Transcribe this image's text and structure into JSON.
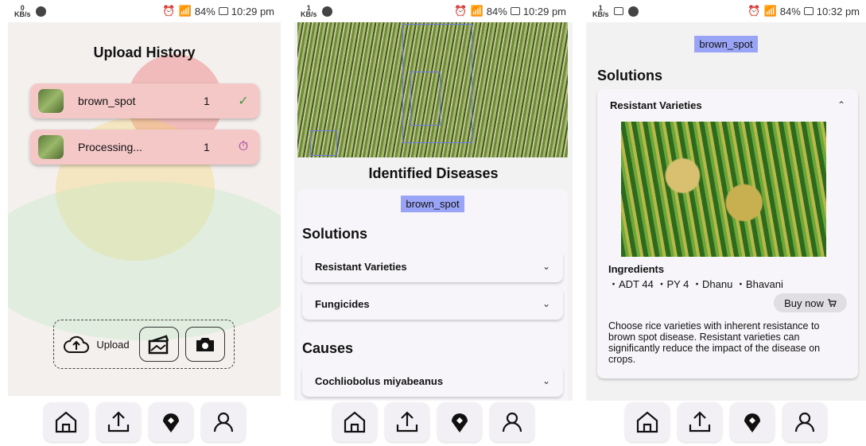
{
  "status": {
    "s1_time": "10:29 pm",
    "s2_time": "10:29 pm",
    "s3_time": "10:32 pm",
    "battery": "84%",
    "left1": "0",
    "left2": "1",
    "left3": "1",
    "kbs": "KB/s"
  },
  "screen1": {
    "title": "Upload History",
    "items": [
      {
        "name": "brown_spot",
        "count": "1",
        "status": "✓"
      },
      {
        "name": "Processing...",
        "count": "1",
        "status": "⏱"
      }
    ],
    "upload_label": "Upload"
  },
  "screen2": {
    "title": "Identified Diseases",
    "tag": "brown_spot",
    "solutions_title": "Solutions",
    "solutions": [
      {
        "label": "Resistant Varieties"
      },
      {
        "label": "Fungicides"
      }
    ],
    "causes_title": "Causes",
    "causes": [
      {
        "label": "Cochliobolus miyabeanus"
      }
    ]
  },
  "screen3": {
    "tag": "brown_spot",
    "solutions_title": "Solutions",
    "expanded_title": "Resistant Varieties",
    "ingredients_title": "Ingredients",
    "ingredients": "・ADT 44 ・PY 4 ・Dhanu ・Bhavani",
    "buy_label": "Buy now",
    "description": "Choose rice varieties with inherent resistance to brown spot disease. Resistant varieties can significantly reduce the impact of the disease on crops."
  },
  "icons": [
    "home-icon",
    "upload-icon",
    "location-icon",
    "profile-icon",
    "cloud-upload-icon",
    "gallery-icon",
    "camera-icon",
    "check-icon",
    "timer-icon",
    "chevron-down-icon",
    "chevron-up-icon",
    "cart-icon"
  ],
  "colors": {
    "tag": "#9aa4f6",
    "history_item": "#f5c8c8",
    "check": "#3a9a3a",
    "timer": "#8a1a8a"
  }
}
